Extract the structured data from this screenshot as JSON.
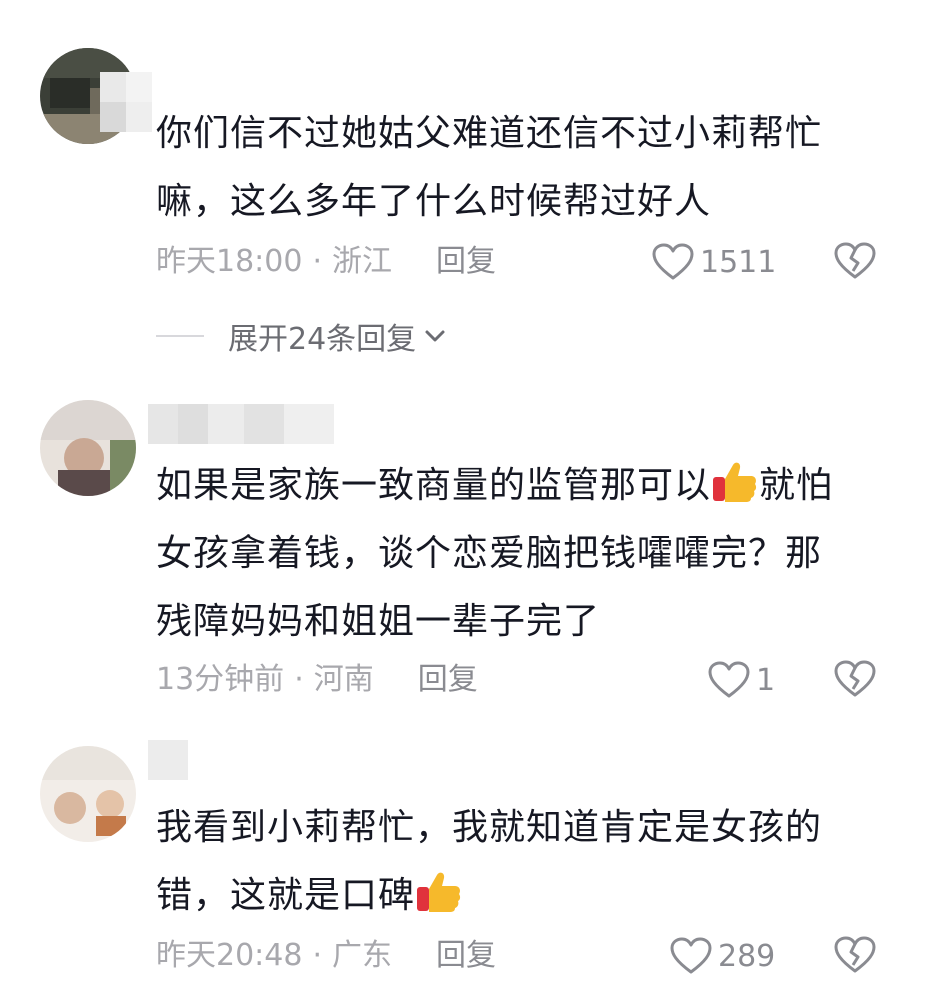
{
  "comments": [
    {
      "text_line1": "你们信不过她姑父难道还信不过小莉帮忙",
      "text_line2": "嘛，这么多年了什么时候帮过好人",
      "time": "昨天18:00",
      "location": "浙江",
      "reply_label": "回复",
      "likes": "1511",
      "expand_label": "展开24条回复"
    },
    {
      "text_line1a": "如果是家族一致商量的监管那可以",
      "emoji": "thumbs-up",
      "text_line1b": "就怕",
      "text_line2": "女孩拿着钱，谈个恋爱脑把钱嚯嚯完？那",
      "text_line3": "残障妈妈和姐姐一辈子完了",
      "time": "13分钟前",
      "location": "河南",
      "reply_label": "回复",
      "likes": "1"
    },
    {
      "text_line1": "我看到小莉帮忙，我就知道肯定是女孩的",
      "text_line2a": "错，这就是口碑",
      "emoji": "thumbs-up",
      "time": "昨天20:48",
      "location": "广东",
      "reply_label": "回复",
      "likes": "289"
    }
  ],
  "separator": "·",
  "icons": {
    "like": "heart-outline-icon",
    "dislike": "broken-heart-icon",
    "expand": "chevron-down-icon"
  },
  "colors": {
    "text": "#161823",
    "meta": "#a8a8ad",
    "icon": "#8a8b91"
  }
}
